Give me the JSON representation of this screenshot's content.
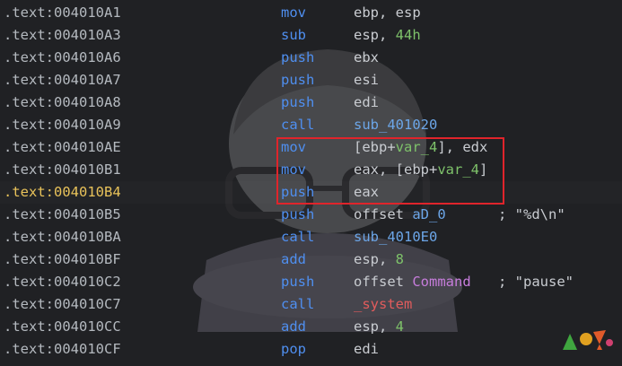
{
  "rows": [
    {
      "seg": ".text:",
      "off": "004010A1",
      "mnem": "mov",
      "ops": [
        {
          "t": "ebp, esp",
          "c": "reg"
        }
      ]
    },
    {
      "seg": ".text:",
      "off": "004010A3",
      "mnem": "sub",
      "ops": [
        {
          "t": "esp, ",
          "c": "reg"
        },
        {
          "t": "44h",
          "c": "num"
        }
      ]
    },
    {
      "seg": ".text:",
      "off": "004010A6",
      "mnem": "push",
      "ops": [
        {
          "t": "ebx",
          "c": "reg"
        }
      ]
    },
    {
      "seg": ".text:",
      "off": "004010A7",
      "mnem": "push",
      "ops": [
        {
          "t": "esi",
          "c": "reg"
        }
      ]
    },
    {
      "seg": ".text:",
      "off": "004010A8",
      "mnem": "push",
      "ops": [
        {
          "t": "edi",
          "c": "reg"
        }
      ]
    },
    {
      "seg": ".text:",
      "off": "004010A9",
      "mnem": "call",
      "ops": [
        {
          "t": "sub_401020",
          "c": "sym"
        }
      ]
    },
    {
      "seg": ".text:",
      "off": "004010AE",
      "mnem": "mov",
      "ops": [
        {
          "t": "[ebp+",
          "c": "reg"
        },
        {
          "t": "var_4",
          "c": "var"
        },
        {
          "t": "], edx",
          "c": "reg"
        }
      ]
    },
    {
      "seg": ".text:",
      "off": "004010B1",
      "mnem": "mov",
      "ops": [
        {
          "t": "eax, [ebp+",
          "c": "reg"
        },
        {
          "t": "var_4",
          "c": "var"
        },
        {
          "t": "]",
          "c": "reg"
        }
      ]
    },
    {
      "seg": ".text:",
      "off": "004010B4",
      "mnem": "push",
      "ops": [
        {
          "t": "eax",
          "c": "reg"
        }
      ],
      "current": true
    },
    {
      "seg": ".text:",
      "off": "004010B5",
      "mnem": "push",
      "ops": [
        {
          "t": "offset ",
          "c": "reg"
        },
        {
          "t": "aD_0",
          "c": "sym"
        }
      ],
      "comment": "; \"%d\\n\""
    },
    {
      "seg": ".text:",
      "off": "004010BA",
      "mnem": "call",
      "ops": [
        {
          "t": "sub_4010E0",
          "c": "sym"
        }
      ]
    },
    {
      "seg": ".text:",
      "off": "004010BF",
      "mnem": "add",
      "ops": [
        {
          "t": "esp, ",
          "c": "reg"
        },
        {
          "t": "8",
          "c": "num"
        }
      ]
    },
    {
      "seg": ".text:",
      "off": "004010C2",
      "mnem": "push",
      "ops": [
        {
          "t": "offset ",
          "c": "reg"
        },
        {
          "t": "Command",
          "c": "cmd"
        }
      ],
      "comment": "; \"pause\""
    },
    {
      "seg": ".text:",
      "off": "004010C7",
      "mnem": "call",
      "ops": [
        {
          "t": "_system",
          "c": "sys"
        }
      ]
    },
    {
      "seg": ".text:",
      "off": "004010CC",
      "mnem": "add",
      "ops": [
        {
          "t": "esp, ",
          "c": "reg"
        },
        {
          "t": "4",
          "c": "num"
        }
      ]
    },
    {
      "seg": ".text:",
      "off": "004010CF",
      "mnem": "pop",
      "ops": [
        {
          "t": "edi",
          "c": "reg"
        }
      ]
    }
  ],
  "colors": {
    "background": "#202124",
    "mnemonic": "#4f8ff0",
    "address": "#b4b9bf",
    "current_address": "#e8c25a",
    "highlight_box": "#e0242b"
  }
}
